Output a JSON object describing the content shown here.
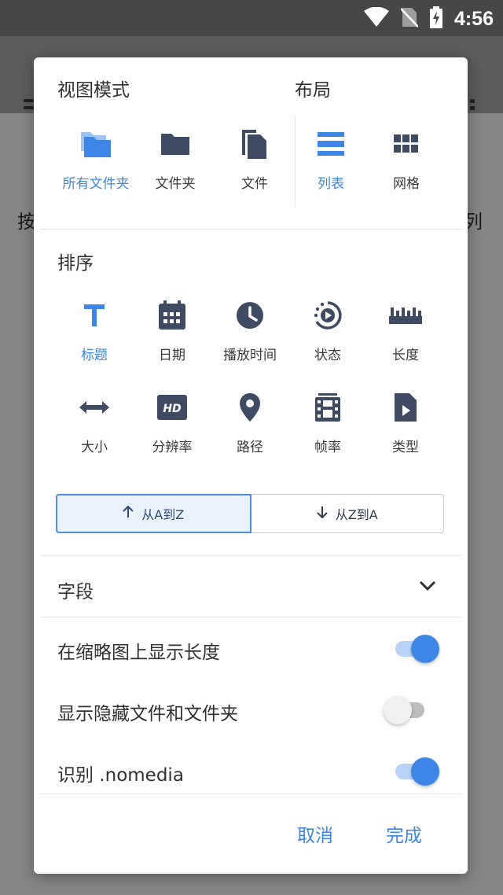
{
  "status_bar": {
    "time": "4:56"
  },
  "background": {
    "left_char": "按",
    "right_char": "列"
  },
  "dialog": {
    "view_mode": {
      "title": "视图模式",
      "options": [
        {
          "label": "所有文件夹",
          "icon": "folder-multiple-icon",
          "selected": true
        },
        {
          "label": "文件夹",
          "icon": "folder-icon",
          "selected": false
        },
        {
          "label": "文件",
          "icon": "file-copy-icon",
          "selected": false
        }
      ]
    },
    "layout": {
      "title": "布局",
      "options": [
        {
          "label": "列表",
          "icon": "list-icon",
          "selected": true
        },
        {
          "label": "网格",
          "icon": "grid-icon",
          "selected": false
        }
      ]
    },
    "sort": {
      "title": "排序",
      "options": [
        {
          "label": "标题",
          "icon": "title-icon",
          "selected": true
        },
        {
          "label": "日期",
          "icon": "calendar-icon",
          "selected": false
        },
        {
          "label": "播放时间",
          "icon": "clock-icon",
          "selected": false
        },
        {
          "label": "状态",
          "icon": "play-status-icon",
          "selected": false
        },
        {
          "label": "长度",
          "icon": "ruler-icon",
          "selected": false
        },
        {
          "label": "大小",
          "icon": "arrows-horizontal-icon",
          "selected": false
        },
        {
          "label": "分辨率",
          "icon": "hd-icon",
          "selected": false
        },
        {
          "label": "路径",
          "icon": "location-pin-icon",
          "selected": false
        },
        {
          "label": "帧率",
          "icon": "film-icon",
          "selected": false
        },
        {
          "label": "类型",
          "icon": "video-file-icon",
          "selected": false
        }
      ],
      "ascending_label": "从A到Z",
      "descending_label": "从Z到A",
      "ascending_selected": true
    },
    "fields": {
      "title": "字段"
    },
    "toggles": [
      {
        "label": "在缩略图上显示长度",
        "on": true
      },
      {
        "label": "显示隐藏文件和文件夹",
        "on": false
      },
      {
        "label": "识别 .nomedia",
        "on": true
      }
    ],
    "actions": {
      "cancel": "取消",
      "done": "完成"
    },
    "colors": {
      "accent": "#3d86e5",
      "icon": "#3f4b63"
    }
  }
}
